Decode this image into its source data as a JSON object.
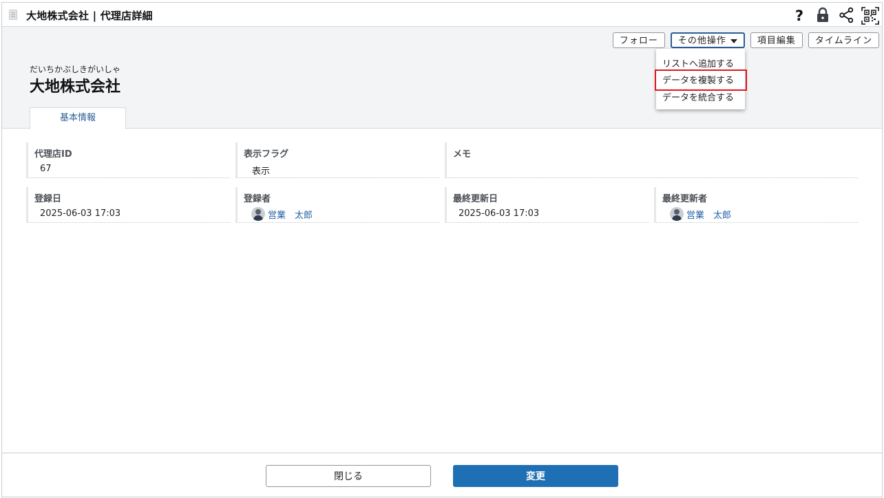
{
  "window": {
    "title": "大地株式会社 | 代理店詳細",
    "icons": [
      "help-icon",
      "lock-icon",
      "share-icon",
      "qr-code-icon"
    ]
  },
  "header": {
    "buttons": {
      "follow": "フォロー",
      "other_actions": "その他操作",
      "edit_fields": "項目編集",
      "timeline": "タイムライン"
    },
    "kana": "だいちかぶしきがいしゃ",
    "company_name": "大地株式会社",
    "tab_basic": "基本情報"
  },
  "dropdown": {
    "items": [
      "リストへ追加する",
      "データを複製する",
      "データを統合する"
    ],
    "highlighted_index": 1,
    "highlight_color": "#e3141b"
  },
  "fields": {
    "agency_id": {
      "label": "代理店ID",
      "value": "67"
    },
    "display_flag": {
      "label": "表示フラグ",
      "value": "表示"
    },
    "memo": {
      "label": "メモ",
      "value": ""
    },
    "registered_date": {
      "label": "登録日",
      "value": "2025-06-03  17:03"
    },
    "registered_by": {
      "label": "登録者",
      "value": "営業　太郎"
    },
    "last_updated_date": {
      "label": "最終更新日",
      "value": "2025-06-03  17:03"
    },
    "last_updated_by": {
      "label": "最終更新者",
      "value": "営業　太郎"
    }
  },
  "footer": {
    "close": "閉じる",
    "change": "変更"
  },
  "colors": {
    "accent": "#1f6fb4",
    "link": "#1f5fa6",
    "header_bg": "#f3f4f6"
  }
}
